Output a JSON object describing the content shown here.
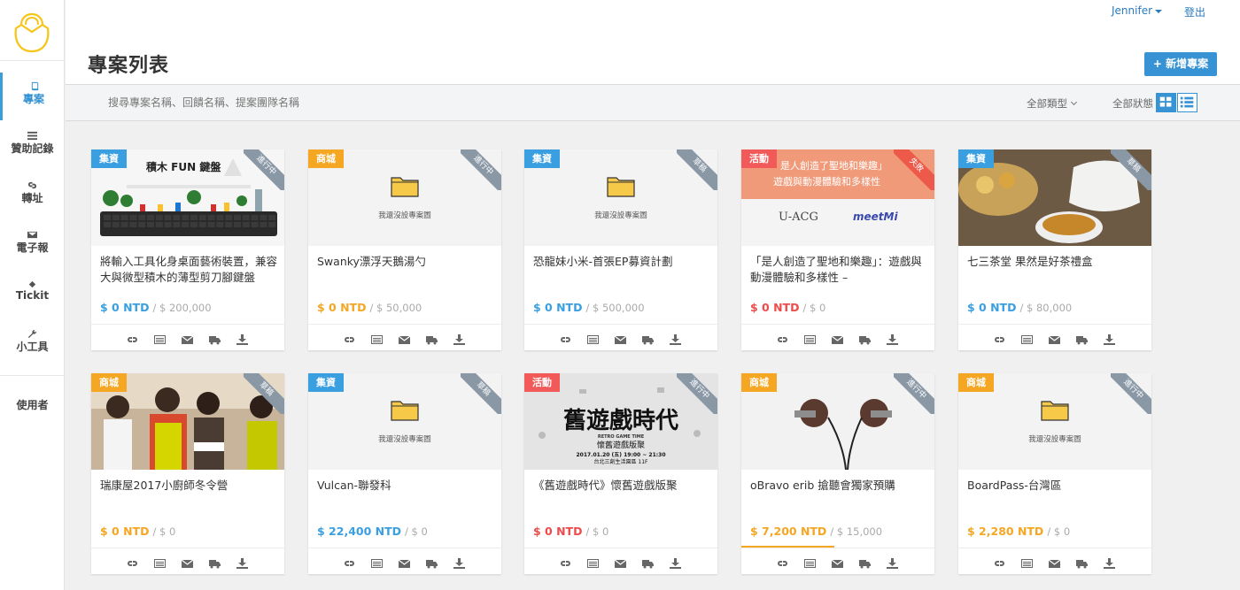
{
  "app": {
    "user_name": "Jennifer",
    "logout_label": "登出",
    "page_title": "專案列表",
    "add_project_label": "新增專案"
  },
  "sidebar": {
    "items": [
      {
        "label": "專案",
        "icon": "book-icon",
        "active": true
      },
      {
        "label": "贊助記錄",
        "icon": "list-icon",
        "active": false
      },
      {
        "label": "轉址",
        "icon": "link-icon",
        "active": false
      },
      {
        "label": "電子報",
        "icon": "envelope-icon",
        "active": false
      },
      {
        "label": "Tickit",
        "icon": "ticket-icon",
        "active": false
      },
      {
        "label": "小工具",
        "icon": "wrench-icon",
        "active": false
      }
    ],
    "user_section_label": "使用者"
  },
  "filters": {
    "search_placeholder": "搜尋專案名稱、回饋名稱、提案團隊名稱",
    "type_label": "全部類型",
    "status_label": "全部狀態"
  },
  "placeholder_text": "我還沒設專案圖",
  "projects": [
    {
      "tag": "集資",
      "ribbon": "進行中",
      "title": "將輸入工具化身桌面藝術裝置，兼容大與微型積木的薄型剪刀腳鍵盤",
      "raised": "$ 0 NTD",
      "goal": "/ $ 200,000",
      "image_text": "積木 FUN 鍵盤"
    },
    {
      "tag": "商城",
      "ribbon": "進行中",
      "title": "Swanky漂浮天鵝湯勺",
      "raised": "$ 0 NTD",
      "goal": "/ $ 50,000"
    },
    {
      "tag": "集資",
      "ribbon": "草稿",
      "title": "恐龍妹小米-首張EP募資計劃",
      "raised": "$ 0 NTD",
      "goal": "/ $ 500,000"
    },
    {
      "tag": "活動",
      "ribbon": "失敗",
      "title": "「是人創造了聖地和樂趣」：遊戲與動漫體驗和多樣性 –",
      "raised": "$ 0 NTD",
      "goal": "/ $ 0",
      "image_text_1": "是人創造了聖地和樂趣」",
      "image_text_2": "遊戲與動漫體驗和多樣性",
      "logo_text": "U-ACG",
      "logo_text_2": "meetMi"
    },
    {
      "tag": "集資",
      "ribbon": "草稿",
      "title": "七三茶堂 果然是好茶禮盒",
      "raised": "$ 0 NTD",
      "goal": "/ $ 80,000"
    },
    {
      "tag": "商城",
      "ribbon": "草稿",
      "title": "瑞康屋2017小廚師冬令營",
      "raised": "$ 0 NTD",
      "goal": "/ $ 0"
    },
    {
      "tag": "集資",
      "ribbon": "草稿",
      "title": "Vulcan-聯發科",
      "raised": "$ 22,400 NTD",
      "goal": "/ $ 0"
    },
    {
      "tag": "活動",
      "ribbon": "進行中",
      "title": "《舊遊戲時代》懷舊遊戲版聚",
      "raised": "$ 0 NTD",
      "goal": "/ $ 0",
      "image_text_1": "舊遊戲時代",
      "image_text_2": "RETRO GAME TIME",
      "image_text_3": "懷舊遊戲版聚",
      "image_text_4": "2017.01.20 (五) 19:00 ~ 21:30",
      "image_text_5": "台北三創生活園區 11F"
    },
    {
      "tag": "商城",
      "ribbon": "進行中",
      "title": "oBravo erib 搶聽會獨家預購",
      "raised": "$ 7,200 NTD",
      "goal": "/ $ 15,000",
      "progress": 0.48
    },
    {
      "tag": "商城",
      "ribbon": "進行中",
      "title": "BoardPass-台灣區",
      "raised": "$ 2,280 NTD",
      "goal": "/ $ 0"
    }
  ],
  "colors": {
    "primary": "#3793d3",
    "fund": "#3a9fe0",
    "shop": "#f5a623",
    "event": "#f25a5a"
  }
}
